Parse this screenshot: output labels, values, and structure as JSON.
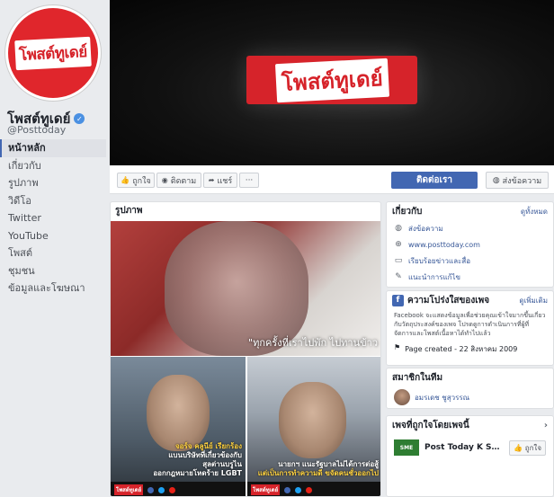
{
  "page": {
    "name": "โพสต์ทูเดย์",
    "handle": "@Posttoday",
    "logo_text": "โพสต์ทูเดย์"
  },
  "nav": {
    "items": [
      {
        "label": "หน้าหลัก",
        "active": true
      },
      {
        "label": "เกี่ยวกับ"
      },
      {
        "label": "รูปภาพ"
      },
      {
        "label": "วิดีโอ"
      },
      {
        "label": "Twitter"
      },
      {
        "label": "YouTube"
      },
      {
        "label": "โพสต์"
      },
      {
        "label": "ชุมชน"
      },
      {
        "label": "ข้อมูลและโฆษณา"
      }
    ]
  },
  "actions": {
    "like": "ถูกใจ",
    "follow": "ติดตาม",
    "share": "แชร์",
    "more": "···",
    "contact": "ติดต่อเรา",
    "message": "ส่งข้อความ"
  },
  "photos": {
    "title": "รูปภาพ",
    "big_quote": "\"ทุกครั้งที่เราไปพัก ไปทานข้าว",
    "left_caption_1": "จอร์จ คลูนีย์ เรียกร้อง",
    "left_caption_2": "แบนบริษัทที่เกี่ยวข้องกับ",
    "left_caption_3": "สุลต่านบรูไน",
    "left_caption_4": "ออกกฎหมายโหดร้าย LGBT",
    "right_caption_1": "นายกฯ แนะรัฐบาลไม่ได้การต่อสู้",
    "right_caption_2": "แต่เป็นการทำความดี ขจัดคนชั่วออกไป",
    "footer_logo": "โพสต์ทูเดย์"
  },
  "about": {
    "title": "เกี่ยวกับ",
    "see_all": "ดูทั้งหมด",
    "rows": [
      {
        "icon": "messenger-icon",
        "text": "ส่งข้อความ"
      },
      {
        "icon": "globe-icon",
        "text": "www.posttoday.com"
      },
      {
        "icon": "pencil-icon",
        "text": "แนะนำการแก้ไข"
      }
    ],
    "row_edit": "เรียบร้อยข่าวและสื่อ"
  },
  "transparency": {
    "title": "ความโปร่งใสของเพจ",
    "see_more": "ดูเพิ่มเติม",
    "desc": "Facebook จะแสดงข้อมูลเพื่อช่วยคุณเข้าใจมากขึ้นเกี่ยวกับวัตถุประสงค์ของเพจ โปรดดูการดำเนินการที่ผู้ที่จัดการและโพสต์เนื้อหาได้ทำไปแล้ว",
    "created": "Page created - 22 สิงหาคม 2009"
  },
  "team": {
    "title": "สมาชิกในทีม",
    "member": "อมรเดช ชูสุวรรณ"
  },
  "liked": {
    "title": "เพจที่ถูกใจโดยเพจนี้",
    "page_name": "Post Today K SM...",
    "like_label": "ถูกใจ",
    "logo": "SME"
  }
}
